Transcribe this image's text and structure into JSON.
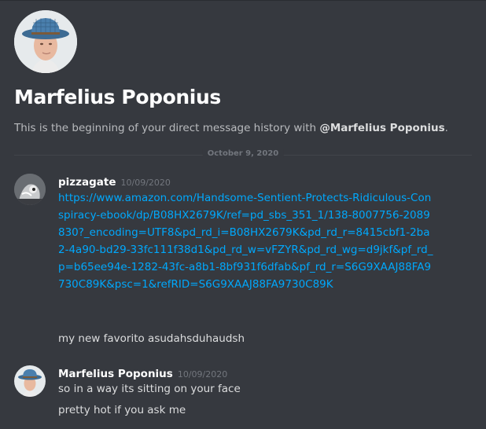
{
  "profile": {
    "name": "Marfelius Poponius",
    "intro_prefix": "This is the beginning of your direct message history with ",
    "intro_mention": "@Marfelius Poponius",
    "intro_suffix": "."
  },
  "date_divider": "October 9, 2020",
  "messages": [
    {
      "author": "pizzagate",
      "timestamp": "10/09/2020",
      "link": "https://www.amazon.com/Handsome-Sentient-Protects-Ridiculous-Conspiracy-ebook/dp/B08HX2679K/ref=pd_sbs_351_1/138-8007756-2089830?_encoding=UTF8&pd_rd_i=B08HX2679K&pd_rd_r=8415cbf1-2ba2-4a90-bd29-33fc111f38d1&pd_rd_w=vFZYR&pd_rd_wg=d9jkf&pf_rd_p=b65ee94e-1282-43fc-a8b1-8bf931f6dfab&pf_rd_r=S6G9XAAJ88FA9730C89K&psc=1&refRID=S6G9XAAJ88FA9730C89K",
      "text": "my new favorito asudahsduhaudsh"
    },
    {
      "author": "Marfelius Poponius",
      "timestamp": "10/09/2020",
      "lines": [
        "so in a way its sitting on your face",
        "pretty hot if you ask me"
      ]
    }
  ],
  "icons": {
    "header_avatar": "avatar-icon",
    "pizzagate_avatar": "avatar-icon",
    "marfelius_avatar": "avatar-icon"
  },
  "colors": {
    "background": "#36393f",
    "link": "#00a8fc",
    "text": "#dcddde",
    "muted": "#b9bbbe",
    "timestamp": "#72767d"
  }
}
